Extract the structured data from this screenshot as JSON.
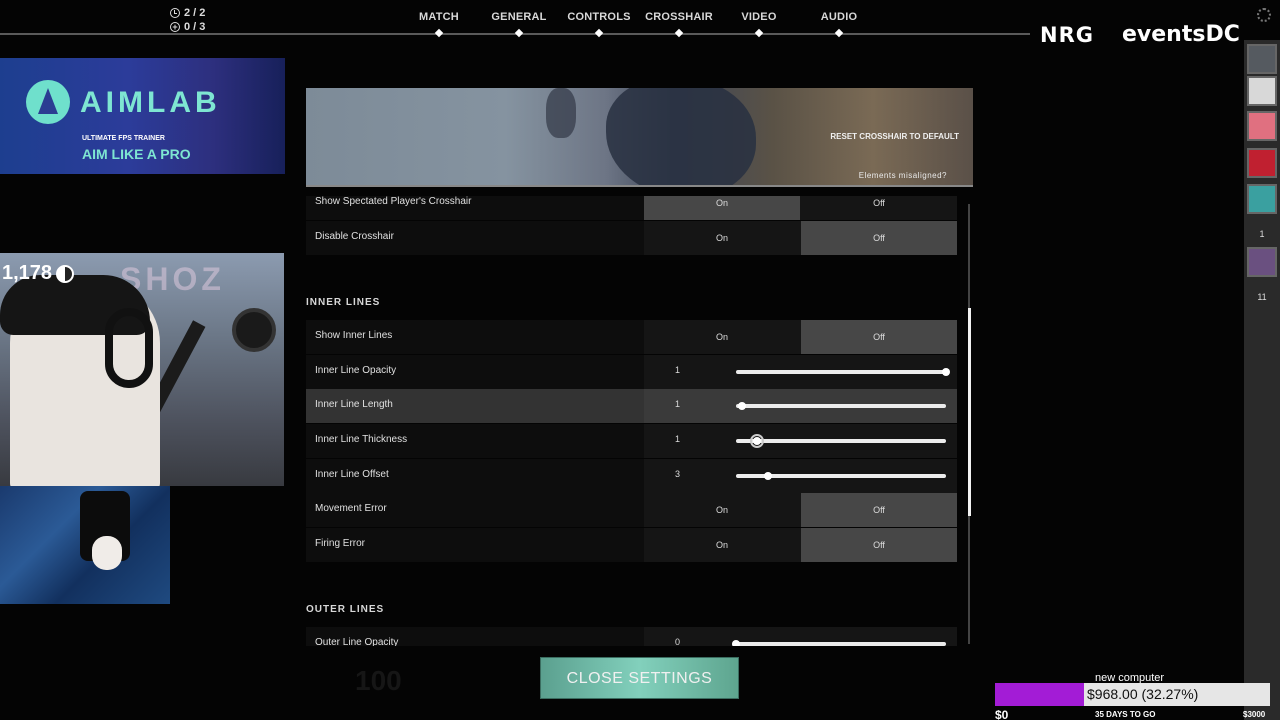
{
  "counters": {
    "clock": "2 / 2",
    "plus": "0 / 3"
  },
  "nav": {
    "tabs": [
      {
        "label": "MATCH"
      },
      {
        "label": "GENERAL"
      },
      {
        "label": "CONTROLS"
      },
      {
        "label": "CROSSHAIR"
      },
      {
        "label": "VIDEO"
      },
      {
        "label": "AUDIO"
      }
    ],
    "active": "CROSSHAIR"
  },
  "sponsors": {
    "nrg": "NRG",
    "events_a": "events",
    "events_b": "DC"
  },
  "aimlab": {
    "brand": "AIMLAB",
    "tagline1": "ULTIMATE FPS TRAINER",
    "tagline2": "AIM LIKE A PRO"
  },
  "webcam": {
    "sub_count": "1,178",
    "wall_text": "SHOZ"
  },
  "banner": {
    "reset_label": "RESET CROSSHAIR TO DEFAULT",
    "misaligned_label": "Elements misaligned?"
  },
  "settings": {
    "rows_top": [
      {
        "label": "Show Spectated Player's Crosshair",
        "type": "toggle",
        "on": "On",
        "off": "Off",
        "value": "On"
      },
      {
        "label": "Disable Crosshair",
        "type": "toggle",
        "on": "On",
        "off": "Off",
        "value": "Off"
      }
    ],
    "inner_lines": {
      "title": "INNER LINES",
      "rows": [
        {
          "label": "Show Inner Lines",
          "type": "toggle",
          "on": "On",
          "off": "Off",
          "value": "Off"
        },
        {
          "label": "Inner Line Opacity",
          "type": "slider",
          "value": "1",
          "fraction": 1.0
        },
        {
          "label": "Inner Line Length",
          "type": "slider",
          "value": "1",
          "fraction": 0.03
        },
        {
          "label": "Inner Line Thickness",
          "type": "slider",
          "value": "1",
          "fraction": 0.1
        },
        {
          "label": "Inner Line Offset",
          "type": "slider",
          "value": "3",
          "fraction": 0.15
        },
        {
          "label": "Movement Error",
          "type": "toggle",
          "on": "On",
          "off": "Off",
          "value": "Off"
        },
        {
          "label": "Firing Error",
          "type": "toggle",
          "on": "On",
          "off": "Off",
          "value": "Off"
        }
      ]
    },
    "outer_lines": {
      "title": "OUTER LINES",
      "rows": [
        {
          "label": "Outer Line Opacity",
          "type": "slider",
          "value": "0",
          "fraction": 0.0
        }
      ]
    },
    "scroll_position": 0.45
  },
  "close_button": "CLOSE SETTINGS",
  "background_ghost": "100",
  "avatars": {
    "colors": [
      "#555a60",
      "#d8d8d8",
      "#e07080",
      "#c02030",
      "#3aa0a0",
      "#6a5080"
    ],
    "counts": [
      "1",
      "11"
    ]
  },
  "goal": {
    "title": "new computer",
    "amount": "$968.00 (32.27%)",
    "progress_percent": 32.27,
    "min": "$0",
    "days_left": "35 DAYS TO GO",
    "max": "$3000",
    "fill_color": "#a31cd6"
  }
}
